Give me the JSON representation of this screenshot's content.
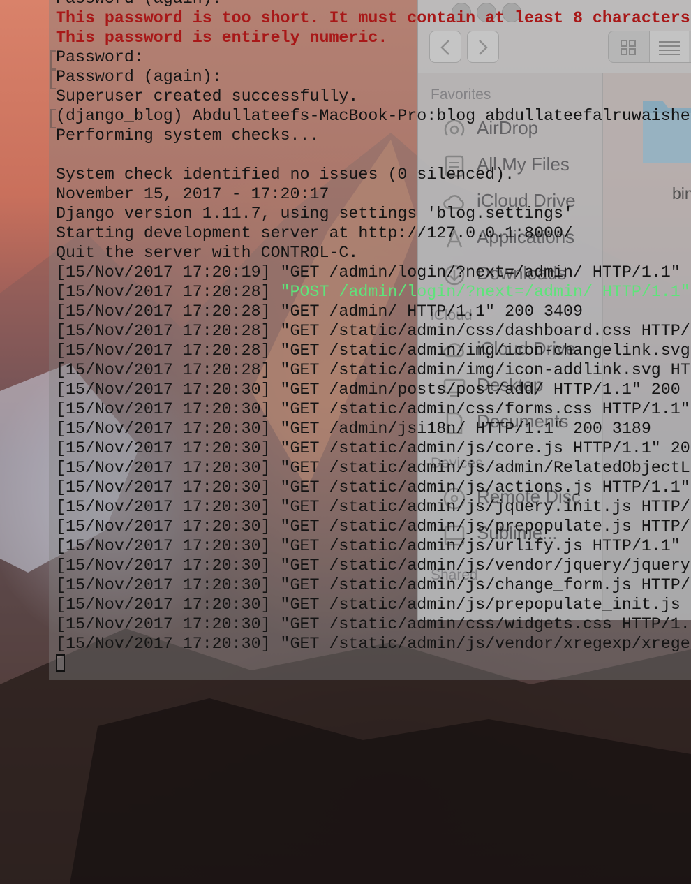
{
  "finder": {
    "favorites_header": "Favorites",
    "icloud_header": "iCloud",
    "devices_header": "Devices",
    "shared_header": "Shared",
    "favorites": [
      {
        "label": "AirDrop",
        "icon": "airdrop-icon"
      },
      {
        "label": "All My Files",
        "icon": "all-files-icon"
      },
      {
        "label": "iCloud Drive",
        "icon": "cloud-icon"
      },
      {
        "label": "Applications",
        "icon": "applications-icon"
      },
      {
        "label": "Downloads",
        "icon": "downloads-icon"
      }
    ],
    "icloud": [
      {
        "label": "iCloud Drive",
        "icon": "cloud-icon"
      },
      {
        "label": "Desktop",
        "icon": "desktop-icon"
      },
      {
        "label": "Documents",
        "icon": "documents-icon"
      }
    ],
    "devices": [
      {
        "label": "Remote Disc",
        "icon": "disc-icon"
      },
      {
        "label": "Sublime...",
        "icon": "drive-icon"
      }
    ],
    "folder_label": "bin"
  },
  "terminal": {
    "lines": [
      {
        "text": "Password (again):",
        "style": "normal"
      },
      {
        "text": "This password is too short. It must contain at least 8 characters",
        "style": "err"
      },
      {
        "text": "This password is entirely numeric.",
        "style": "err"
      },
      {
        "text": "Password:",
        "style": "normal"
      },
      {
        "text": "Password (again):",
        "style": "normal"
      },
      {
        "text": "Superuser created successfully.",
        "style": "normal"
      },
      {
        "text": "(django_blog) Abdullateefs-MacBook-Pro:blog abdullateefalruwaishe",
        "style": "normal"
      },
      {
        "text": "Performing system checks...",
        "style": "normal"
      },
      {
        "text": "",
        "style": "normal"
      },
      {
        "text": "System check identified no issues (0 silenced).",
        "style": "normal"
      },
      {
        "text": "November 15, 2017 - 17:20:17",
        "style": "normal"
      },
      {
        "text": "Django version 1.11.7, using settings 'blog.settings'",
        "style": "normal"
      },
      {
        "text": "Starting development server at http://127.0.0.1:8000/",
        "style": "normal"
      },
      {
        "text": "Quit the server with CONTROL-C.",
        "style": "normal"
      },
      {
        "text": "[15/Nov/2017 17:20:19] \"GET /admin/login/?next=/admin/ HTTP/1.1\"",
        "style": "normal"
      },
      {
        "text": "[15/Nov/2017 17:20:28] ",
        "post": "\"POST /admin/login/?next=/admin/ HTTP/1.1\"",
        "style": "post"
      },
      {
        "text": "[15/Nov/2017 17:20:28] \"GET /admin/ HTTP/1.1\" 200 3409",
        "style": "normal"
      },
      {
        "text": "[15/Nov/2017 17:20:28] \"GET /static/admin/css/dashboard.css HTTP/",
        "style": "normal"
      },
      {
        "text": "[15/Nov/2017 17:20:28] \"GET /static/admin/img/icon-changelink.svg",
        "style": "normal"
      },
      {
        "text": "[15/Nov/2017 17:20:28] \"GET /static/admin/img/icon-addlink.svg HT",
        "style": "normal"
      },
      {
        "text": "[15/Nov/2017 17:20:30] \"GET /admin/posts/post/add/ HTTP/1.1\" 200",
        "style": "normal"
      },
      {
        "text": "[15/Nov/2017 17:20:30] \"GET /static/admin/css/forms.css HTTP/1.1\"",
        "style": "normal"
      },
      {
        "text": "[15/Nov/2017 17:20:30] \"GET /admin/jsi18n/ HTTP/1.1\" 200 3189",
        "style": "normal"
      },
      {
        "text": "[15/Nov/2017 17:20:30] \"GET /static/admin/js/core.js HTTP/1.1\" 20",
        "style": "normal"
      },
      {
        "text": "[15/Nov/2017 17:20:30] \"GET /static/admin/js/admin/RelatedObjectL",
        "style": "normal"
      },
      {
        "text": "[15/Nov/2017 17:20:30] \"GET /static/admin/js/actions.js HTTP/1.1\"",
        "style": "normal"
      },
      {
        "text": "[15/Nov/2017 17:20:30] \"GET /static/admin/js/jquery.init.js HTTP/",
        "style": "normal"
      },
      {
        "text": "[15/Nov/2017 17:20:30] \"GET /static/admin/js/prepopulate.js HTTP/",
        "style": "normal"
      },
      {
        "text": "[15/Nov/2017 17:20:30] \"GET /static/admin/js/urlify.js HTTP/1.1\"",
        "style": "normal"
      },
      {
        "text": "[15/Nov/2017 17:20:30] \"GET /static/admin/js/vendor/jquery/jquery",
        "style": "normal"
      },
      {
        "text": "[15/Nov/2017 17:20:30] \"GET /static/admin/js/change_form.js HTTP/",
        "style": "normal"
      },
      {
        "text": "[15/Nov/2017 17:20:30] \"GET /static/admin/js/prepopulate_init.js",
        "style": "normal"
      },
      {
        "text": "[15/Nov/2017 17:20:30] \"GET /static/admin/css/widgets.css HTTP/1.",
        "style": "normal"
      },
      {
        "text": "[15/Nov/2017 17:20:30] \"GET /static/admin/js/vendor/xregexp/xrege",
        "style": "normal"
      }
    ]
  }
}
